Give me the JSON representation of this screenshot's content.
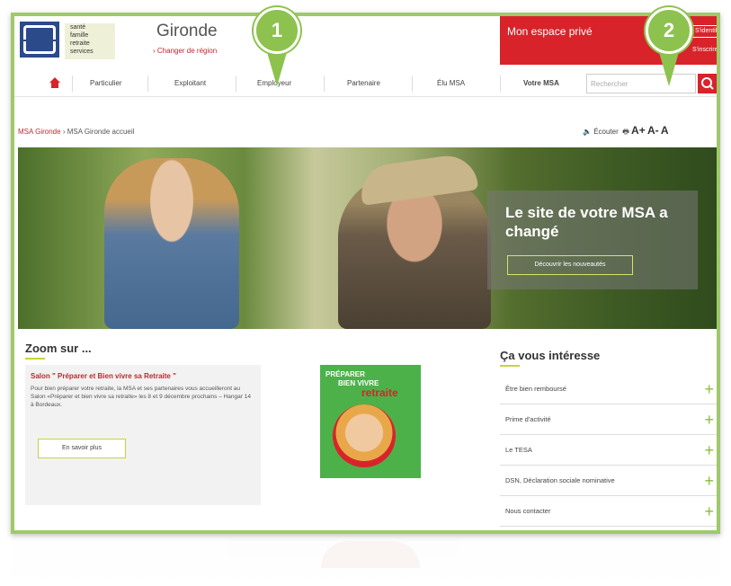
{
  "header": {
    "logo_lines": [
      "santé",
      "famille",
      "retraite",
      "services"
    ],
    "region": "Gironde",
    "change_region": "› Changer de région",
    "space_label": "Mon espace privé",
    "space_button": "S'identifier",
    "space_link": "S'inscrire"
  },
  "nav": {
    "items": [
      "Particulier",
      "Exploitant",
      "Employeur",
      "Partenaire",
      "Élu MSA",
      "Votre MSA"
    ],
    "search_placeholder": "Rechercher"
  },
  "breadcrumb": {
    "home": "MSA Gironde",
    "current": "› MSA Gironde accueil"
  },
  "tools": {
    "listen": "Écouter",
    "a_plus": "A+",
    "a_minus": "A-",
    "a": "A"
  },
  "hero": {
    "headline": "Le site de votre MSA a changé",
    "button": "Découvrir les nouveautés"
  },
  "zoom": {
    "title": "Zoom sur ...",
    "headline": "Salon \" Préparer et Bien vivre sa Retraite \"",
    "text": "Pour bien préparer votre retraite, la MSA et ses partenaires vous accueilleront au Salon «Préparer et bien vivre sa retraite» les 8 et 9 décembre prochains – Hangar 14 à Bordeaux.",
    "button": "En savoir plus"
  },
  "poster": {
    "line1": "PRÉPARER",
    "line2": "BIEN VIVRE",
    "line3": "retraite"
  },
  "interest": {
    "title": "Ça vous intéresse",
    "items": [
      "Être bien remboursé",
      "Prime d'activité",
      "Le TESA",
      "DSN, Déclaration sociale nominative",
      "Nous contacter"
    ]
  },
  "callouts": [
    "1",
    "2"
  ],
  "colors": {
    "accent_red": "#d9232a",
    "accent_green": "#8dc24f",
    "frame_green": "#9fc96a"
  }
}
